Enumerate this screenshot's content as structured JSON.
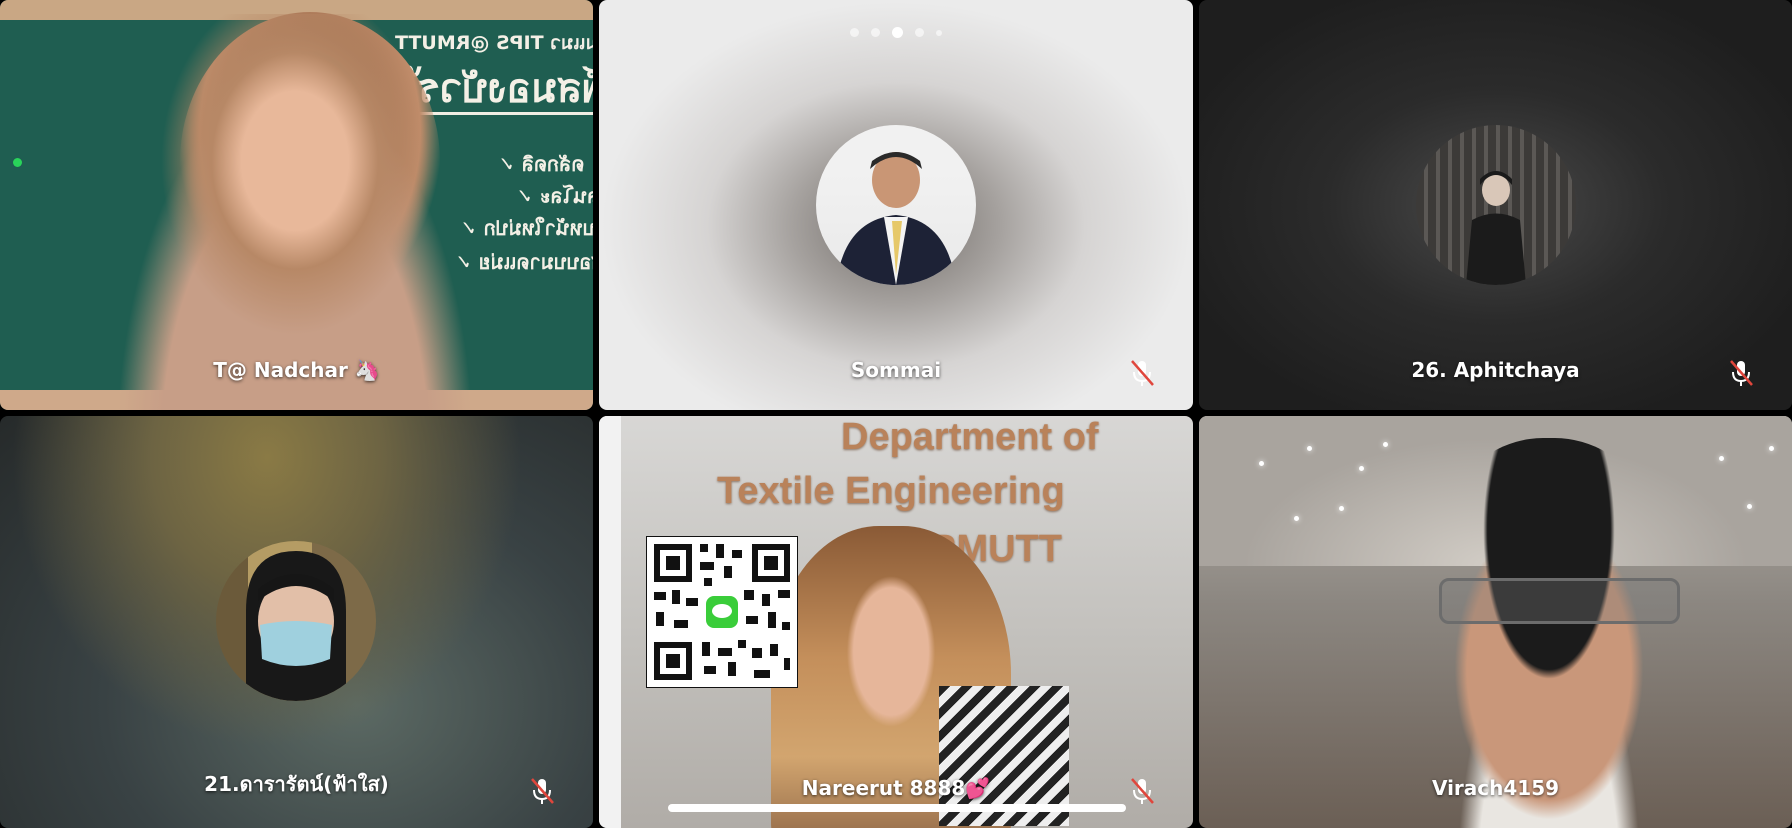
{
  "pager": {
    "count": 5,
    "active_index": 2
  },
  "participants": [
    {
      "name": "T@ Nadchar 🦄",
      "muted": false,
      "video": true
    },
    {
      "name": "Sommai",
      "muted": true,
      "video": false
    },
    {
      "name": "26. Aphitchaya",
      "muted": true,
      "video": false
    },
    {
      "name": "21.ดารารัตน์(ฟ้าใส)",
      "muted": true,
      "video": false
    },
    {
      "name": "Nareerut 8888💕",
      "muted": true,
      "video": true
    },
    {
      "name": "Virach4159",
      "muted": false,
      "video": true
    }
  ],
  "background_text": {
    "chalkboard_lines": [
      "มุมแมว TIPS @RMUTT",
      "จิตพิมพ์สมองบัวรไ",
      "ดลักดลิ ✓",
      "โลนโละ ✓",
      "นับหน้าใหม่ปก ✓",
      "สอบบมาดแม่ย ✓"
    ],
    "banner_lines": [
      "Department of",
      "Textile Engineering",
      "RMUTT"
    ]
  },
  "colors": {
    "chalkboard": "#1f5e51",
    "mute_slash": "#e0463c",
    "banner_text": "#b9825a"
  }
}
